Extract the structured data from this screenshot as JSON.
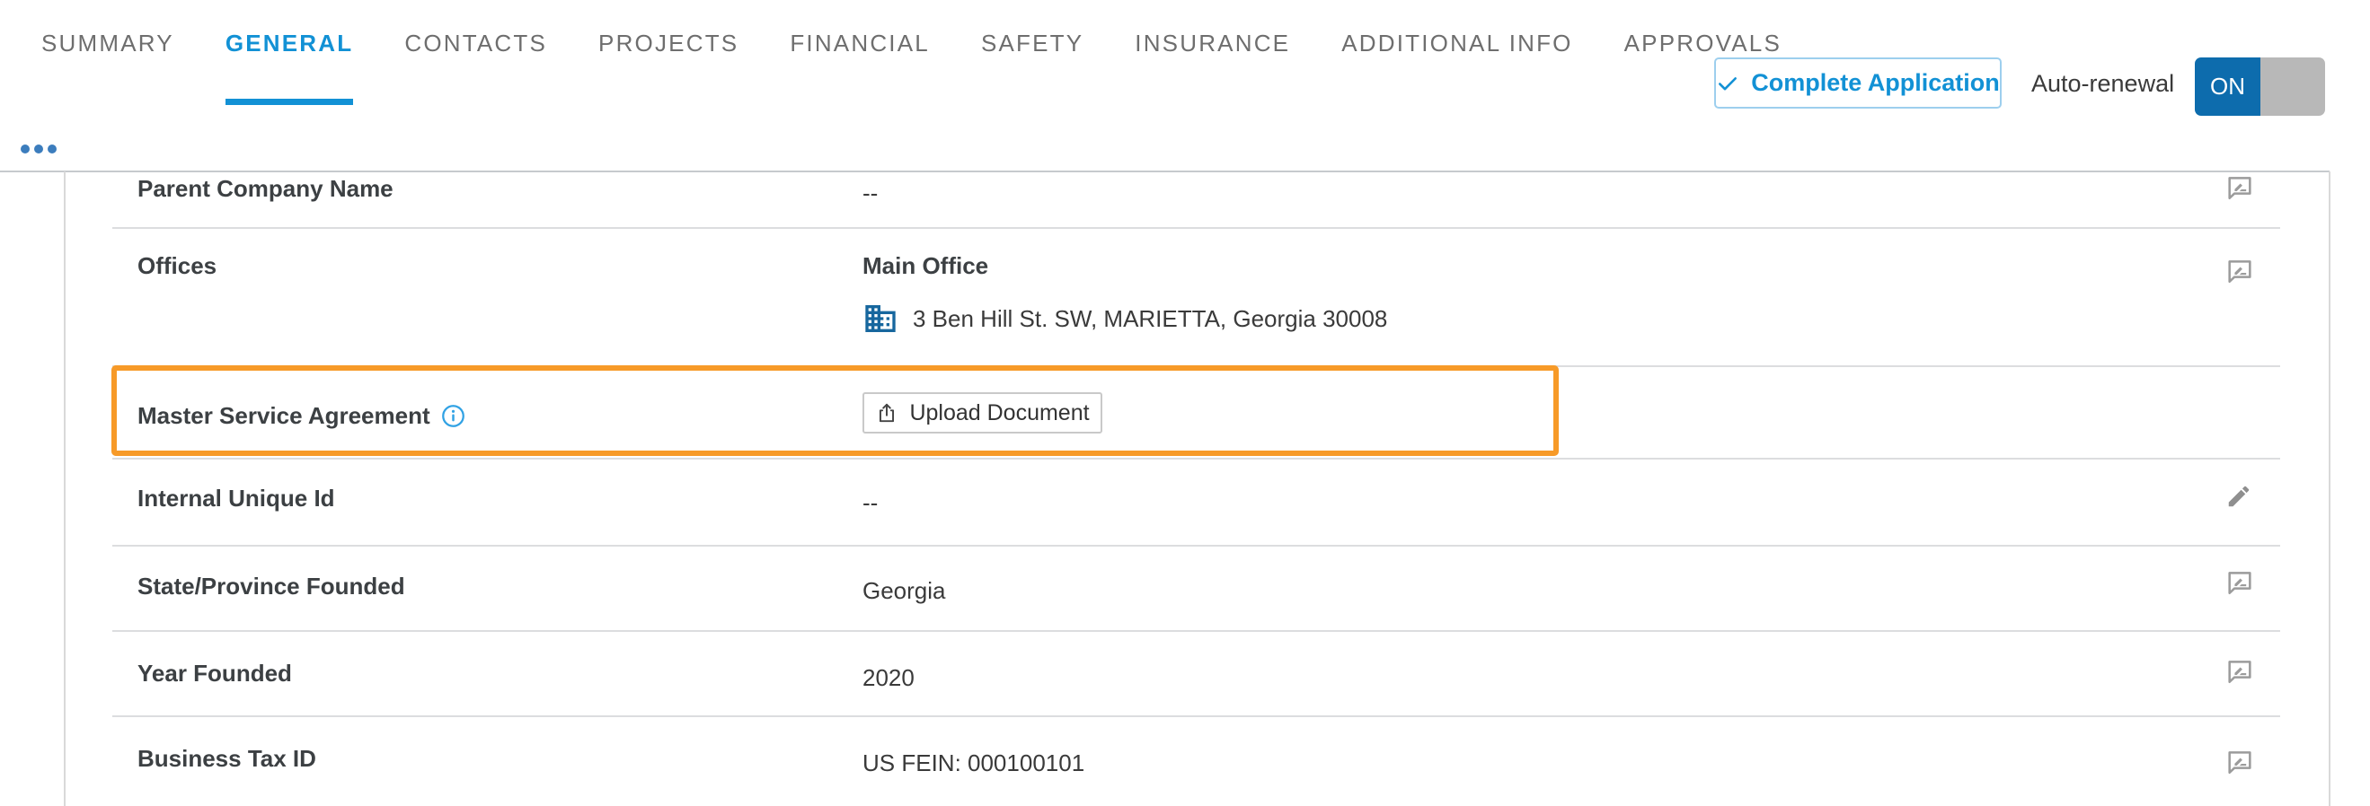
{
  "tabs": {
    "items": [
      {
        "label": "SUMMARY",
        "active": false
      },
      {
        "label": "GENERAL",
        "active": true
      },
      {
        "label": "CONTACTS",
        "active": false
      },
      {
        "label": "PROJECTS",
        "active": false
      },
      {
        "label": "FINANCIAL",
        "active": false
      },
      {
        "label": "SAFETY",
        "active": false
      },
      {
        "label": "INSURANCE",
        "active": false
      },
      {
        "label": "ADDITIONAL INFO",
        "active": false
      },
      {
        "label": "APPROVALS",
        "active": false
      }
    ]
  },
  "header": {
    "complete_button": "Complete Application",
    "auto_renewal_label": "Auto-renewal",
    "toggle_state": "ON",
    "overflow_icon": "ellipsis-icon"
  },
  "rows": [
    {
      "label": "Parent Company Name",
      "value": "--",
      "icon": "rate-review-icon"
    },
    {
      "label": "Offices",
      "office": {
        "name": "Main Office",
        "address": "3 Ben Hill St. SW, MARIETTA, Georgia 30008",
        "icon": "building-icon"
      },
      "icon": "rate-review-icon"
    },
    {
      "label": "Master Service Agreement",
      "info_icon": "info-icon",
      "upload_button": "Upload Document",
      "upload_icon": "upload-icon",
      "highlighted": true
    },
    {
      "label": "Internal Unique Id",
      "value": "--",
      "icon": "edit-pencil-icon"
    },
    {
      "label": "State/Province Founded",
      "value": "Georgia",
      "icon": "rate-review-icon"
    },
    {
      "label": "Year Founded",
      "value": "2020",
      "icon": "rate-review-icon"
    },
    {
      "label": "Business Tax ID",
      "value": "US FEIN: 000100101",
      "icon": "rate-review-icon"
    }
  ],
  "colors": {
    "accent_blue": "#1291d5",
    "toggle_on_blue": "#0d6cad",
    "toggle_off_gray": "#b8b8b8",
    "highlight_orange": "#f79a28",
    "icon_gray": "#9b9b9b",
    "building_blue": "#17679e",
    "info_blue": "#31a2e4",
    "dots_blue": "#3c7dbd"
  }
}
